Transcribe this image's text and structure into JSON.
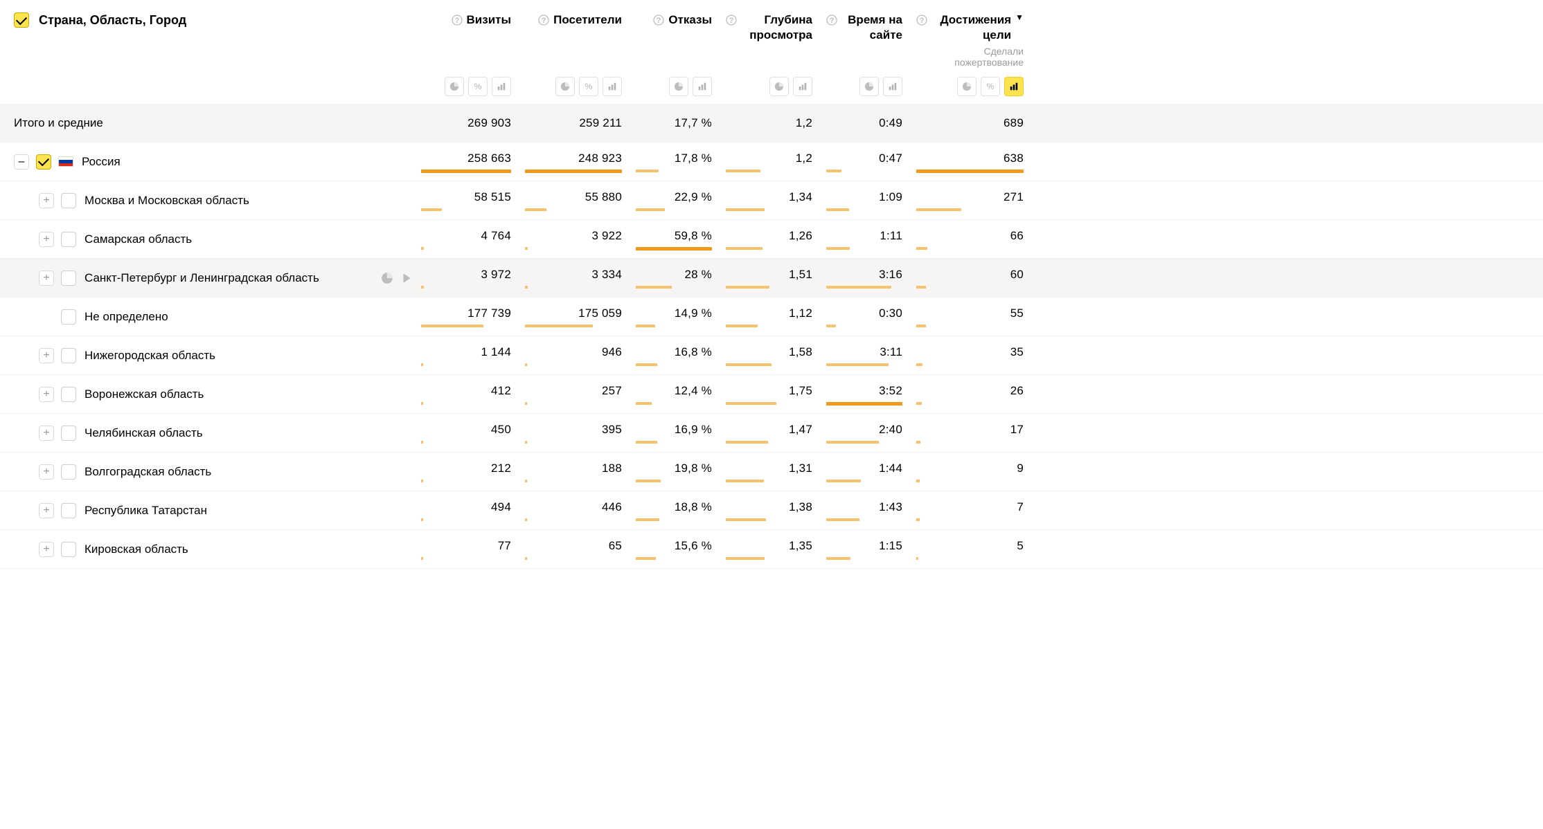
{
  "header": {
    "dimension_label": "Страна, Область, Город",
    "columns": {
      "visits": "Визиты",
      "visitors": "Посетители",
      "bounce": "Отказы",
      "depth": "Глубина просмотра",
      "time": "Время на сайте",
      "goals": "Достижения цели",
      "goals_sub": "Сделали пожертвование"
    }
  },
  "totals": {
    "label": "Итого и средние",
    "visits": "269 903",
    "visitors": "259 211",
    "bounce": "17,7 %",
    "depth": "1,2",
    "time": "0:49",
    "goals": "689"
  },
  "groups": [
    {
      "name": "Россия",
      "checked": true,
      "expanded": true,
      "flag": "ru",
      "visits": "258 663",
      "visitors": "248 923",
      "bounce": "17,8 %",
      "depth": "1,2",
      "time": "0:47",
      "goals": "638",
      "bars": {
        "visits": 100,
        "visitors": 100,
        "bounce": 30,
        "depth": 40,
        "time": 20,
        "goals": 100
      }
    }
  ],
  "rows": [
    {
      "name": "Москва и Московская область",
      "visits": "58 515",
      "visitors": "55 880",
      "bounce": "22,9 %",
      "depth": "1,34",
      "time": "1:09",
      "goals": "271",
      "bars": {
        "visits": 23,
        "visitors": 22,
        "bounce": 38,
        "depth": 45,
        "time": 30,
        "goals": 42
      }
    },
    {
      "name": "Самарская область",
      "visits": "4 764",
      "visitors": "3 922",
      "bounce": "59,8 %",
      "depth": "1,26",
      "time": "1:11",
      "goals": "66",
      "bars": {
        "visits": 3,
        "visitors": 3,
        "bounce": 100,
        "depth": 42,
        "time": 31,
        "goals": 10
      }
    },
    {
      "name": "Санкт-Петербург и Ленинградская область",
      "hovered": true,
      "visits": "3 972",
      "visitors": "3 334",
      "bounce": "28 %",
      "depth": "1,51",
      "time": "3:16",
      "goals": "60",
      "bars": {
        "visits": 3,
        "visitors": 3,
        "bounce": 47,
        "depth": 50,
        "time": 85,
        "goals": 9
      }
    },
    {
      "name": "Не определено",
      "no_expand": true,
      "visits": "177 739",
      "visitors": "175 059",
      "bounce": "14,9 %",
      "depth": "1,12",
      "time": "0:30",
      "goals": "55",
      "bars": {
        "visits": 69,
        "visitors": 70,
        "bounce": 25,
        "depth": 37,
        "time": 13,
        "goals": 9
      }
    },
    {
      "name": "Нижегородская область",
      "visits": "1 144",
      "visitors": "946",
      "bounce": "16,8 %",
      "depth": "1,58",
      "time": "3:11",
      "goals": "35",
      "bars": {
        "visits": 2,
        "visitors": 2,
        "bounce": 28,
        "depth": 53,
        "time": 82,
        "goals": 6
      }
    },
    {
      "name": "Воронежская область",
      "visits": "412",
      "visitors": "257",
      "bounce": "12,4 %",
      "depth": "1,75",
      "time": "3:52",
      "goals": "26",
      "bars": {
        "visits": 2,
        "visitors": 2,
        "bounce": 21,
        "depth": 58,
        "time": 100,
        "goals": 5
      }
    },
    {
      "name": "Челябинская область",
      "visits": "450",
      "visitors": "395",
      "bounce": "16,9 %",
      "depth": "1,47",
      "time": "2:40",
      "goals": "17",
      "bars": {
        "visits": 2,
        "visitors": 2,
        "bounce": 28,
        "depth": 49,
        "time": 69,
        "goals": 4
      }
    },
    {
      "name": "Волгоградская область",
      "visits": "212",
      "visitors": "188",
      "bounce": "19,8 %",
      "depth": "1,31",
      "time": "1:44",
      "goals": "9",
      "bars": {
        "visits": 2,
        "visitors": 2,
        "bounce": 33,
        "depth": 44,
        "time": 45,
        "goals": 3
      }
    },
    {
      "name": "Республика Татарстан",
      "visits": "494",
      "visitors": "446",
      "bounce": "18,8 %",
      "depth": "1,38",
      "time": "1:43",
      "goals": "7",
      "bars": {
        "visits": 2,
        "visitors": 2,
        "bounce": 31,
        "depth": 46,
        "time": 44,
        "goals": 3
      }
    },
    {
      "name": "Кировская область",
      "visits": "77",
      "visitors": "65",
      "bounce": "15,6 %",
      "depth": "1,35",
      "time": "1:15",
      "goals": "5",
      "bars": {
        "visits": 2,
        "visitors": 2,
        "bounce": 26,
        "depth": 45,
        "time": 32,
        "goals": 2
      }
    }
  ]
}
